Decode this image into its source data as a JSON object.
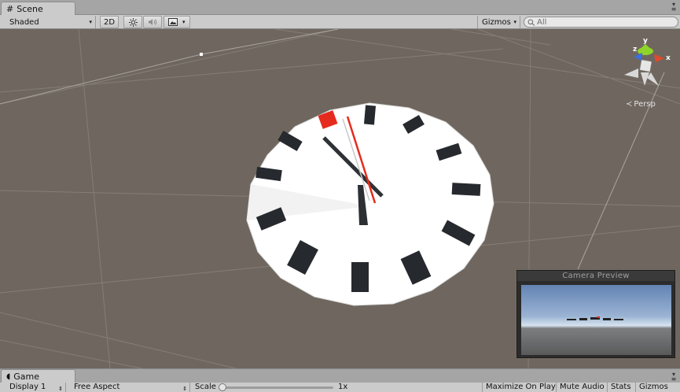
{
  "scene_tab": {
    "label": "Scene",
    "icon": "scene-grid-icon"
  },
  "toolbar": {
    "shading_mode": "Shaded",
    "mode_2d": "2D",
    "gizmos_label": "Gizmos",
    "search_placeholder": "All",
    "lighting_icon": "sun-icon",
    "audio_icon": "speaker-icon",
    "effects_icon": "image-icon"
  },
  "scene": {
    "persp_label": "Persp",
    "gizmo_axes": [
      "y",
      "z",
      "x"
    ],
    "axis_colors": {
      "x": "#e0492d",
      "y": "#8fd42a",
      "z": "#3a6fdc"
    },
    "clock_hour_markers": 12
  },
  "camera_preview": {
    "title": "Camera Preview"
  },
  "game_tab": {
    "label": "Game",
    "icon": "pacman-icon"
  },
  "game_toolbar": {
    "display": "Display 1",
    "aspect": "Free Aspect",
    "scale_label": "Scale",
    "scale_value": "1x",
    "maximize_on_play": "Maximize On Play",
    "mute_audio": "Mute Audio",
    "stats": "Stats",
    "gizmos": "Gizmos"
  }
}
